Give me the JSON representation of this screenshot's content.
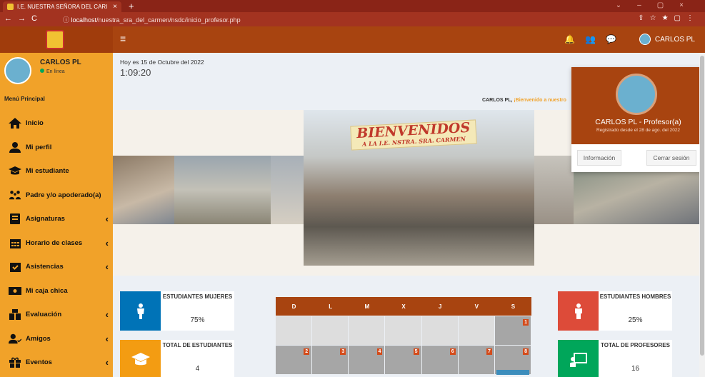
{
  "browser": {
    "tab_title": "I.E. NUESTRA SEÑORA DEL CARI",
    "url_host": "localhost",
    "url_path": "/nuestra_sra_del_carmen/nsdc/inicio_profesor.php"
  },
  "topbar": {
    "user_name": "CARLOS PL",
    "icons": [
      "bell-icon",
      "users-icon",
      "chat-icon"
    ]
  },
  "sidebar": {
    "user_name": "CARLOS PL",
    "status": "En línea",
    "header": "Menú Principal",
    "items": [
      {
        "label": "Inicio",
        "icon": "home-icon",
        "chevron": false
      },
      {
        "label": "Mi perfil",
        "icon": "user-icon",
        "chevron": false
      },
      {
        "label": "Mi estudiante",
        "icon": "graduation-cap-icon",
        "chevron": false
      },
      {
        "label": "Padre y/o apoderado(a)",
        "icon": "family-icon",
        "chevron": false
      },
      {
        "label": "Asignaturas",
        "icon": "book-icon",
        "chevron": true
      },
      {
        "label": "Horario de clases",
        "icon": "calendar-icon",
        "chevron": true
      },
      {
        "label": "Asistencias",
        "icon": "calendar-check-icon",
        "chevron": true
      },
      {
        "label": "Mi caja chica",
        "icon": "money-icon",
        "chevron": false
      },
      {
        "label": "Evaluación",
        "icon": "evaluation-icon",
        "chevron": true
      },
      {
        "label": "Amigos",
        "icon": "user-check-icon",
        "chevron": true
      },
      {
        "label": "Eventos",
        "icon": "gift-icon",
        "chevron": true
      }
    ]
  },
  "main": {
    "date": "Hoy es 15 de Octubre del 2022",
    "time": "1:09:20",
    "welcome_user": "CARLOS PL,",
    "welcome_text": " ¡Bienvenido a nuestro",
    "banner_sign_1": "BIENVENIDOS",
    "banner_sign_2": "A LA I.E. NSTRA. SRA. CARMEN"
  },
  "profile_popup": {
    "name": "CARLOS PL - Profesor(a)",
    "since": "Registrado desde el 28 de ago. del 2022",
    "info_button": "Información",
    "logout_button": "Cerrar sesión"
  },
  "stats": {
    "mujeres": {
      "label": "ESTUDIANTES MUJERES",
      "value": "75%",
      "color": "#0073b7"
    },
    "total": {
      "label": "TOTAL DE ESTUDIANTES",
      "value": "4",
      "color": "#f39c12"
    },
    "hombres": {
      "label": "ESTUDIANTES HOMBRES",
      "value": "25%",
      "color": "#dd4b39"
    },
    "profesores": {
      "label": "TOTAL DE PROFESORES",
      "value": "16",
      "color": "#00a65a"
    }
  },
  "calendar": {
    "days": [
      "D",
      "L",
      "M",
      "X",
      "J",
      "V",
      "S"
    ],
    "week1": [
      "",
      "",
      "",
      "",
      "",
      "",
      "1"
    ],
    "week2": [
      "2",
      "3",
      "4",
      "5",
      "6",
      "7",
      "8"
    ]
  }
}
